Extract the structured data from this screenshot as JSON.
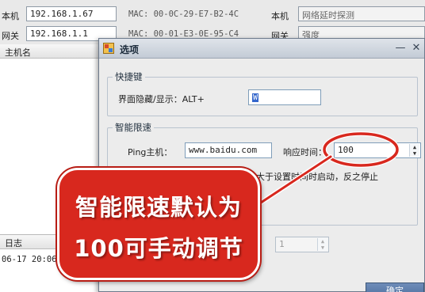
{
  "main_window": {
    "row1": {
      "host_label": "本机",
      "host_ip": "192.168.1.67",
      "mac": "MAC: 00-0C-29-E7-B2-4C",
      "right_label": "本机",
      "right_value": "网络延时探测"
    },
    "row2": {
      "gateway_label": "网关",
      "gateway_ip": "192.168.1.1",
      "mac": "MAC: 00-01-E3-0E-95-C4",
      "right_label": "网关",
      "right_value": "强度"
    },
    "host_panel": {
      "header": "主机名"
    },
    "log_panel": {
      "header": "日志",
      "lines": [
        "06-17 20:06"
      ]
    }
  },
  "dialog": {
    "title": "选项",
    "controls": {
      "minimize": "—",
      "close": "✕"
    },
    "shortcut_group": {
      "legend": "快捷键",
      "label": "界面隐藏/显示：ALT+",
      "value": "W"
    },
    "speed_group": {
      "legend": "智能限速",
      "ping_label": "Ping主机：",
      "ping_value": "www.baidu.com",
      "response_label": "响应时间：",
      "response_value": "100",
      "desc_text": "时间大于设置时间时启动，反之停止"
    },
    "disabled_spinner_value": "1",
    "ok_button": "确定"
  },
  "callout": {
    "line1": "智能限速默认为",
    "line2": "100可手动调节",
    "color": "#d8281e"
  },
  "icons": {
    "app": "app-window-icon",
    "spin_up": "spin-up-icon",
    "spin_down": "spin-down-icon"
  }
}
